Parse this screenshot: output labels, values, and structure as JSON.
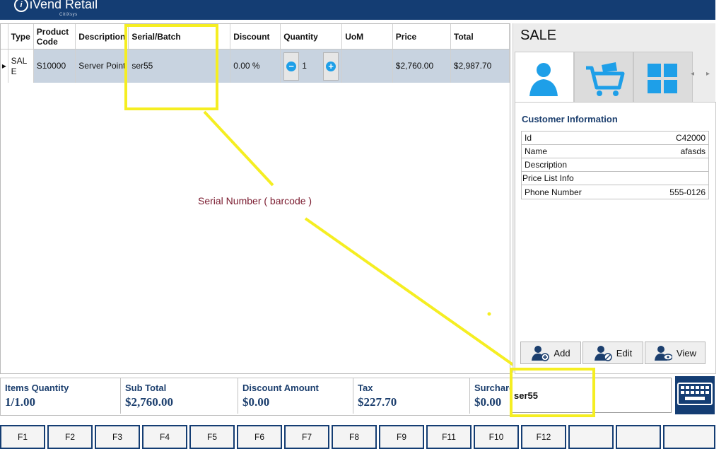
{
  "app": {
    "logo_text": "iVend Retail",
    "logo_mark": "i",
    "logo_sub": "CitiXsys"
  },
  "grid": {
    "columns": [
      "Type",
      "Product Code",
      "Description",
      "Serial/Batch",
      "Discount",
      "Quantity",
      "UoM",
      "Price",
      "Total"
    ],
    "row": {
      "type": "SALE",
      "product_code": "S10000",
      "description": "Server Point",
      "serial": "ser55",
      "discount": "0.00 %",
      "quantity": "1",
      "uom": "",
      "price": "$2,760.00",
      "total": "$2,987.70"
    }
  },
  "annotation": {
    "text": "Serial Number ( barcode )"
  },
  "right_panel": {
    "title": "SALE",
    "customer": {
      "title": "Customer Information",
      "rows": [
        {
          "label": "Id",
          "value": "C42000"
        },
        {
          "label": "Name",
          "value": "afasds"
        },
        {
          "label": "Description",
          "value": ""
        },
        {
          "label": "Price List Info",
          "value": ""
        },
        {
          "label": "Phone Number",
          "value": "555-0126"
        }
      ]
    },
    "buttons": {
      "add": "Add",
      "edit": "Edit",
      "view": "View"
    }
  },
  "totals": {
    "items_quantity": {
      "label": "Items Quantity",
      "value": "1/1.00"
    },
    "sub_total": {
      "label": "Sub Total",
      "value": "$2,760.00"
    },
    "discount_amount": {
      "label": "Discount Amount",
      "value": "$0.00"
    },
    "tax": {
      "label": "Tax",
      "value": "$227.70"
    },
    "surcharge": {
      "label": "Surcharge",
      "value": "$0.00"
    }
  },
  "scan_input": {
    "value": "ser55"
  },
  "fkeys": [
    "F1",
    "F2",
    "F3",
    "F4",
    "F5",
    "F6",
    "F7",
    "F8",
    "F9",
    "F11",
    "F10",
    "F12",
    "",
    "",
    ""
  ],
  "colors": {
    "brand": "#143d73",
    "highlight": "#f5ee22",
    "accent": "#1e9fe8",
    "annotation": "#7a1a2e"
  }
}
